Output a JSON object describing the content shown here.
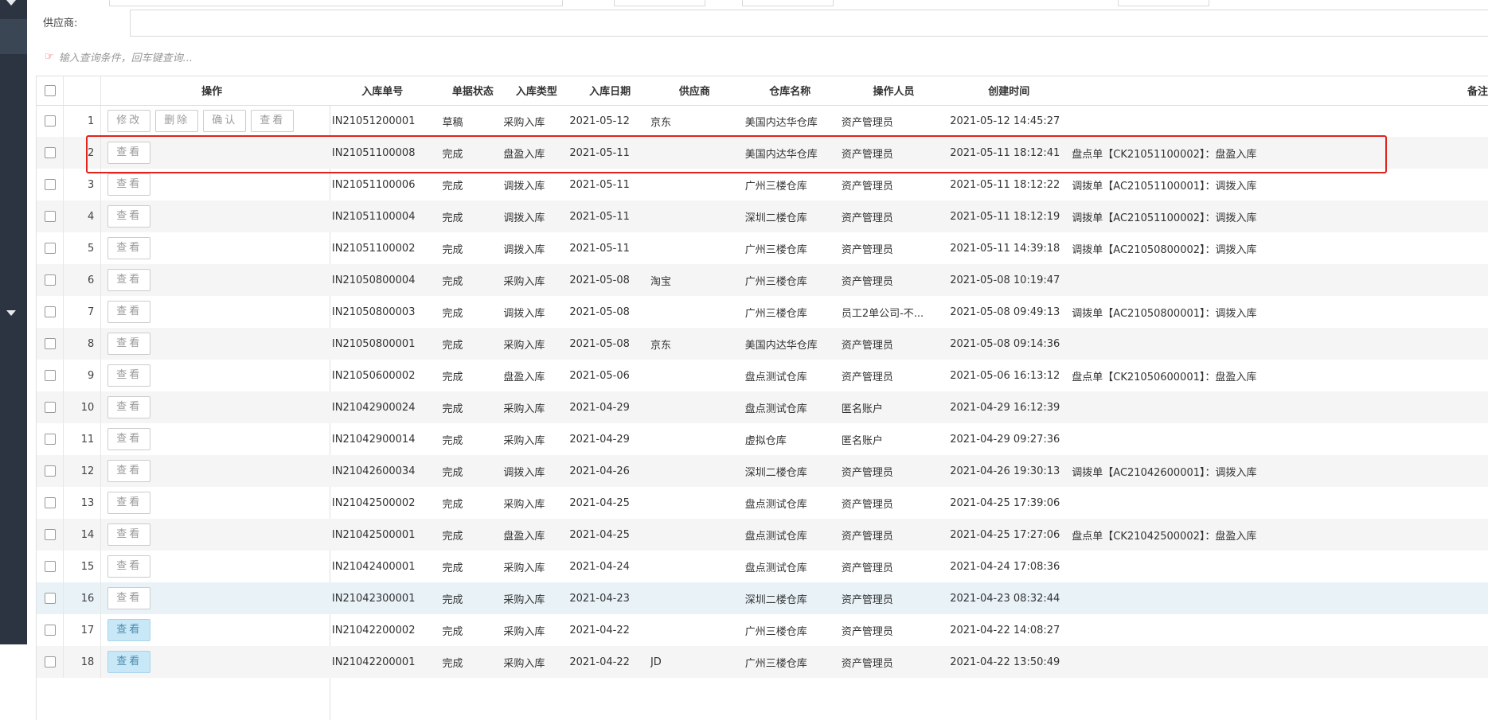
{
  "filter": {
    "supplier_label": "供应商:",
    "search_hint": "输入查询条件，回车键查询..."
  },
  "columns": {
    "ops": "操作",
    "code": "入库单号",
    "status": "单据状态",
    "type": "入库类型",
    "date": "入库日期",
    "supplier": "供应商",
    "warehouse": "仓库名称",
    "operator": "操作人员",
    "created": "创建时间",
    "remark": "备注"
  },
  "buttons": {
    "edit": "修改",
    "delete": "删除",
    "confirm": "确认",
    "view": "查看"
  },
  "rows": [
    {
      "no": "1",
      "code": "IN21051200001",
      "status": "草稿",
      "type": "采购入库",
      "date": "2021-05-12",
      "supplier": "京东",
      "warehouse": "美国内达华仓库",
      "operator": "资产管理员",
      "created": "2021-05-12 14:45:27",
      "remark": ""
    },
    {
      "no": "2",
      "code": "IN21051100008",
      "status": "完成",
      "type": "盘盈入库",
      "date": "2021-05-11",
      "supplier": "",
      "warehouse": "美国内达华仓库",
      "operator": "资产管理员",
      "created": "2021-05-11 18:12:41",
      "remark": "盘点单【CK21051100002】：盘盈入库"
    },
    {
      "no": "3",
      "code": "IN21051100006",
      "status": "完成",
      "type": "调拨入库",
      "date": "2021-05-11",
      "supplier": "",
      "warehouse": "广州三楼仓库",
      "operator": "资产管理员",
      "created": "2021-05-11 18:12:22",
      "remark": "调拨单【AC21051100001】：调拨入库"
    },
    {
      "no": "4",
      "code": "IN21051100004",
      "status": "完成",
      "type": "调拨入库",
      "date": "2021-05-11",
      "supplier": "",
      "warehouse": "深圳二楼仓库",
      "operator": "资产管理员",
      "created": "2021-05-11 18:12:19",
      "remark": "调拨单【AC21051100002】：调拨入库"
    },
    {
      "no": "5",
      "code": "IN21051100002",
      "status": "完成",
      "type": "调拨入库",
      "date": "2021-05-11",
      "supplier": "",
      "warehouse": "广州三楼仓库",
      "operator": "资产管理员",
      "created": "2021-05-11 14:39:18",
      "remark": "调拨单【AC21050800002】：调拨入库"
    },
    {
      "no": "6",
      "code": "IN21050800004",
      "status": "完成",
      "type": "采购入库",
      "date": "2021-05-08",
      "supplier": "淘宝",
      "warehouse": "广州三楼仓库",
      "operator": "资产管理员",
      "created": "2021-05-08 10:19:47",
      "remark": ""
    },
    {
      "no": "7",
      "code": "IN21050800003",
      "status": "完成",
      "type": "调拨入库",
      "date": "2021-05-08",
      "supplier": "",
      "warehouse": "广州三楼仓库",
      "operator": "员工2单公司-不...",
      "created": "2021-05-08 09:49:13",
      "remark": "调拨单【AC21050800001】：调拨入库"
    },
    {
      "no": "8",
      "code": "IN21050800001",
      "status": "完成",
      "type": "采购入库",
      "date": "2021-05-08",
      "supplier": "京东",
      "warehouse": "美国内达华仓库",
      "operator": "资产管理员",
      "created": "2021-05-08 09:14:36",
      "remark": ""
    },
    {
      "no": "9",
      "code": "IN21050600002",
      "status": "完成",
      "type": "盘盈入库",
      "date": "2021-05-06",
      "supplier": "",
      "warehouse": "盘点测试仓库",
      "operator": "资产管理员",
      "created": "2021-05-06 16:13:12",
      "remark": "盘点单【CK21050600001】：盘盈入库"
    },
    {
      "no": "10",
      "code": "IN21042900024",
      "status": "完成",
      "type": "采购入库",
      "date": "2021-04-29",
      "supplier": "",
      "warehouse": "盘点测试仓库",
      "operator": "匿名账户",
      "created": "2021-04-29 16:12:39",
      "remark": ""
    },
    {
      "no": "11",
      "code": "IN21042900014",
      "status": "完成",
      "type": "采购入库",
      "date": "2021-04-29",
      "supplier": "",
      "warehouse": "虚拟仓库",
      "operator": "匿名账户",
      "created": "2021-04-29 09:27:36",
      "remark": ""
    },
    {
      "no": "12",
      "code": "IN21042600034",
      "status": "完成",
      "type": "调拨入库",
      "date": "2021-04-26",
      "supplier": "",
      "warehouse": "深圳二楼仓库",
      "operator": "资产管理员",
      "created": "2021-04-26 19:30:13",
      "remark": "调拨单【AC21042600001】：调拨入库"
    },
    {
      "no": "13",
      "code": "IN21042500002",
      "status": "完成",
      "type": "采购入库",
      "date": "2021-04-25",
      "supplier": "",
      "warehouse": "盘点测试仓库",
      "operator": "资产管理员",
      "created": "2021-04-25 17:39:06",
      "remark": ""
    },
    {
      "no": "14",
      "code": "IN21042500001",
      "status": "完成",
      "type": "盘盈入库",
      "date": "2021-04-25",
      "supplier": "",
      "warehouse": "盘点测试仓库",
      "operator": "资产管理员",
      "created": "2021-04-25 17:27:06",
      "remark": "盘点单【CK21042500002】：盘盈入库"
    },
    {
      "no": "15",
      "code": "IN21042400001",
      "status": "完成",
      "type": "采购入库",
      "date": "2021-04-24",
      "supplier": "",
      "warehouse": "盘点测试仓库",
      "operator": "资产管理员",
      "created": "2021-04-24 17:08:36",
      "remark": ""
    },
    {
      "no": "16",
      "code": "IN21042300001",
      "status": "完成",
      "type": "采购入库",
      "date": "2021-04-23",
      "supplier": "",
      "warehouse": "深圳二楼仓库",
      "operator": "资产管理员",
      "created": "2021-04-23 08:32:44",
      "remark": ""
    },
    {
      "no": "17",
      "code": "IN21042200002",
      "status": "完成",
      "type": "采购入库",
      "date": "2021-04-22",
      "supplier": "",
      "warehouse": "广州三楼仓库",
      "operator": "资产管理员",
      "created": "2021-04-22 14:08:27",
      "remark": ""
    },
    {
      "no": "18",
      "code": "IN21042200001",
      "status": "完成",
      "type": "采购入库",
      "date": "2021-04-22",
      "supplier": "JD",
      "warehouse": "广州三楼仓库",
      "operator": "资产管理员",
      "created": "2021-04-22 13:50:49",
      "remark": ""
    }
  ],
  "colors": {
    "sidebar": "#2b3440",
    "highlight": "#e0241b",
    "active_button": "#c9e8f7",
    "hover_row": "#e8f2f7"
  }
}
